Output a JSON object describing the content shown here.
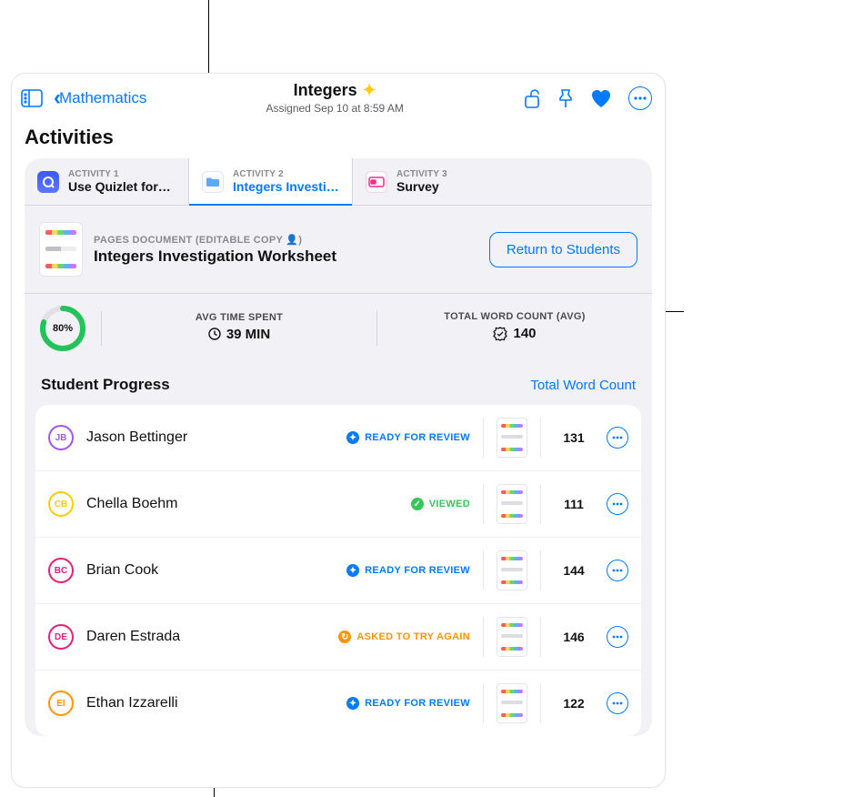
{
  "header": {
    "back_label": "Mathematics",
    "title": "Integers",
    "subtitle": "Assigned Sep 10 at 8:59 AM"
  },
  "activities": {
    "heading": "Activities",
    "tabs": [
      {
        "eyebrow": "ACTIVITY 1",
        "label": "Use Quizlet for…",
        "icon": "quizlet"
      },
      {
        "eyebrow": "ACTIVITY 2",
        "label": "Integers Investi…",
        "icon": "folder"
      },
      {
        "eyebrow": "ACTIVITY 3",
        "label": "Survey",
        "icon": "survey"
      }
    ],
    "selected_index": 1
  },
  "document": {
    "eyebrow": "PAGES DOCUMENT (EDITABLE COPY 👤)",
    "title": "Integers Investigation Worksheet",
    "return_button": "Return to Students"
  },
  "stats": {
    "completion_pct": "80%",
    "completion_value": 80,
    "avg_time_label": "AVG TIME SPENT",
    "avg_time_value": "39 MIN",
    "word_count_label": "TOTAL WORD COUNT (AVG)",
    "word_count_value": "140"
  },
  "progress": {
    "heading": "Student Progress",
    "sort_label": "Total Word Count",
    "students": [
      {
        "initials": "JB",
        "color": "#a056ff",
        "name": "Jason Bettinger",
        "status": "READY FOR REVIEW",
        "status_kind": "review",
        "count": "131"
      },
      {
        "initials": "CB",
        "color": "#ffcc00",
        "name": "Chella Boehm",
        "status": "VIEWED",
        "status_kind": "viewed",
        "count": "111"
      },
      {
        "initials": "BC",
        "color": "#e81f77",
        "name": "Brian Cook",
        "status": "READY FOR REVIEW",
        "status_kind": "review",
        "count": "144"
      },
      {
        "initials": "DE",
        "color": "#e81f77",
        "name": "Daren Estrada",
        "status": "ASKED TO TRY AGAIN",
        "status_kind": "tryagain",
        "count": "146"
      },
      {
        "initials": "EI",
        "color": "#ff9500",
        "name": "Ethan Izzarelli",
        "status": "READY FOR REVIEW",
        "status_kind": "review",
        "count": "122"
      }
    ]
  },
  "status_styles": {
    "review": {
      "color": "#007aff",
      "glyph": "✦"
    },
    "viewed": {
      "color": "#34c759",
      "glyph": "✓"
    },
    "tryagain": {
      "color": "#ff9500",
      "glyph": "↻"
    }
  }
}
